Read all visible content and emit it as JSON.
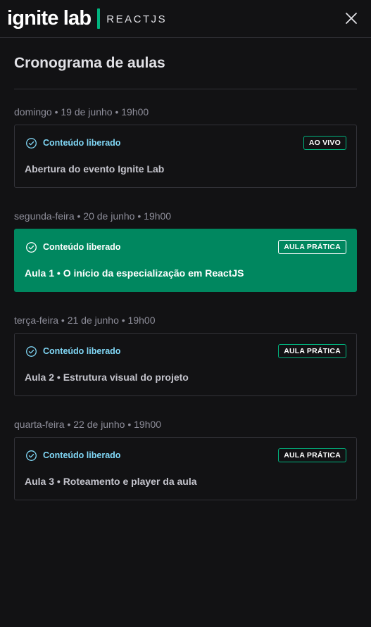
{
  "header": {
    "logo_text": "ignite lab",
    "logo_subtitle": "REACTJS",
    "accent_color": "#00b37e",
    "close_icon": "close-icon"
  },
  "main": {
    "title": "Cronograma de aulas",
    "lessons": [
      {
        "date": "domingo • 19 de junho • 19h00",
        "status": "Conteúdo liberado",
        "badge": "AO VIVO",
        "title": "Abertura do evento Ignite Lab",
        "active": false
      },
      {
        "date": "segunda-feira • 20 de junho • 19h00",
        "status": "Conteúdo liberado",
        "badge": "AULA PRÁTICA",
        "title": "Aula 1 • O início da especialização em ReactJS",
        "active": true
      },
      {
        "date": "terça-feira • 21 de junho • 19h00",
        "status": "Conteúdo liberado",
        "badge": "AULA PRÁTICA",
        "title": "Aula 2 • Estrutura visual do projeto",
        "active": false
      },
      {
        "date": "quarta-feira • 22 de junho • 19h00",
        "status": "Conteúdo liberado",
        "badge": "AULA PRÁTICA",
        "title": "Aula 3 • Roteamento e player da aula",
        "active": false
      }
    ]
  },
  "colors": {
    "background": "#121214",
    "active_card": "#00875f",
    "status_blue": "#81d8f7"
  }
}
